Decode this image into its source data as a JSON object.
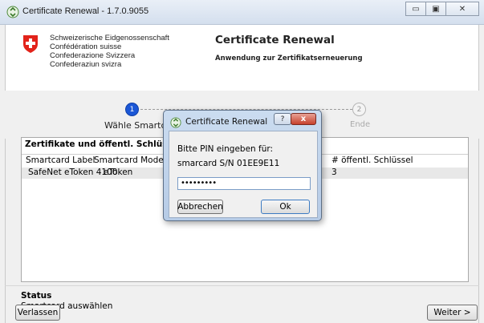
{
  "window": {
    "title": "Certificate Renewal - 1.7.0.9055"
  },
  "header": {
    "federation_lines": [
      "Schweizerische Eidgenossenschaft",
      "Confédération suisse",
      "Confederazione Svizzera",
      "Confederaziun svizra"
    ],
    "title": "Certificate Renewal",
    "subtitle": "Anwendung zur Zertifikatserneuerung"
  },
  "steps": [
    {
      "number": "1",
      "label": "Wähle Smartcard"
    },
    {
      "number": "2",
      "label": "Ende"
    }
  ],
  "panel": {
    "title": "Zertifikate und öffentl. Schlüssel auf der Smartcard",
    "columns": [
      "Smartcard Label",
      "Smartcard Modell",
      "# öffentl. Schlüssel"
    ],
    "rows": [
      {
        "label": "SafeNet eToken 4100",
        "model": "eToken",
        "keys": "3"
      }
    ]
  },
  "status": {
    "title": "Status",
    "text": "Smartcard auswählen"
  },
  "buttons": {
    "leave": "Verlassen",
    "next": "Weiter >"
  },
  "dialog": {
    "title": "Certificate Renewal",
    "prompt": "Bitte PIN eingeben für:",
    "target": "smarcard S/N 01EE9E11",
    "pin_value": "•••••••••",
    "cancel": "Abbrechen",
    "ok": "Ok",
    "help_glyph": "?",
    "close_glyph": "x"
  },
  "colors": {
    "step_active": "#1b57d6",
    "swiss_red": "#e2231a"
  }
}
